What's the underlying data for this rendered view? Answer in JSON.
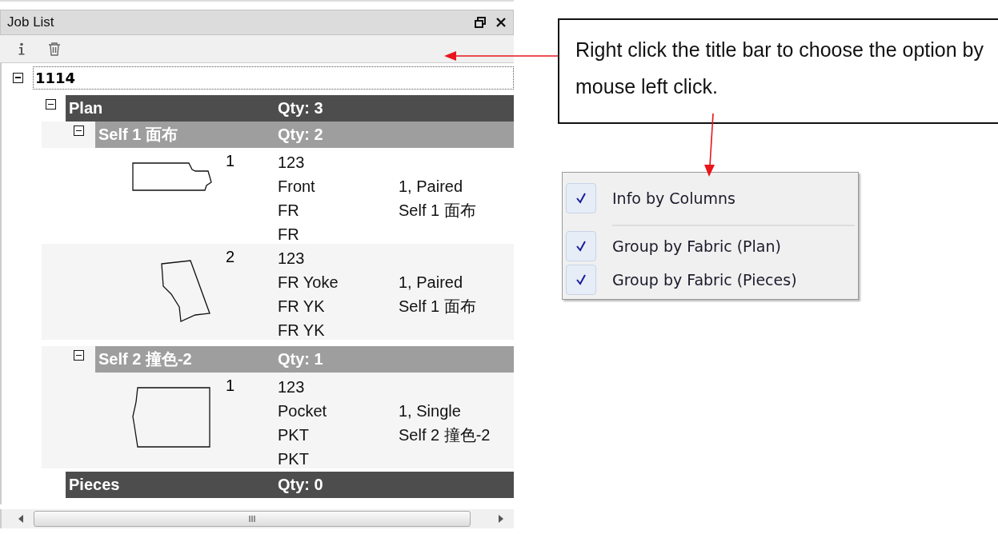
{
  "panel": {
    "title": "Job List"
  },
  "tree": {
    "label": "1114",
    "expanded": true,
    "children": [
      {
        "label": "Plan",
        "qty": "Qty: 3",
        "expanded": true,
        "children": [
          {
            "label": "Self 1 面布",
            "qty": "Qty: 2",
            "expanded": true,
            "children": [
              {
                "kind": "front",
                "number": "1",
                "lines": [
                  "123",
                  "Front",
                  "FR",
                  "FR"
                ],
                "info": [
                  "1, Paired",
                  "Self 1 面布"
                ],
                "shaded": false
              },
              {
                "kind": "yoke",
                "number": "2",
                "lines": [
                  "123",
                  "FR Yoke",
                  "FR YK",
                  "FR YK"
                ],
                "info": [
                  "1, Paired",
                  "Self 1 面布"
                ],
                "shaded": true
              }
            ]
          },
          {
            "label": "Self 2 撞色-2",
            "qty": "Qty: 1",
            "expanded": true,
            "children": [
              {
                "kind": "pocket",
                "number": "1",
                "lines": [
                  "123",
                  "Pocket",
                  "PKT",
                  "PKT"
                ],
                "info": [
                  "1, Single",
                  "Self 2 撞色-2"
                ],
                "shaded": true
              }
            ]
          }
        ]
      },
      {
        "label": "Pieces",
        "qty": "Qty: 0"
      }
    ]
  },
  "callout": {
    "text": "Right click the title bar to choose the option by mouse left click."
  },
  "context_menu": {
    "sections": [
      [
        {
          "label": "Info by Columns",
          "checked": true
        }
      ],
      [
        {
          "label": "Group by Fabric (Plan)",
          "checked": true
        },
        {
          "label": "Group by Fabric (Pieces)",
          "checked": true
        }
      ]
    ]
  }
}
